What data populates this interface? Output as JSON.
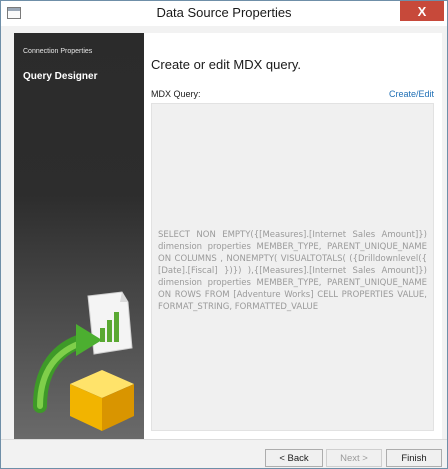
{
  "window": {
    "title": "Data Source Properties",
    "close_glyph": "X"
  },
  "sidebar": {
    "items": [
      {
        "label": "Connection Properties"
      },
      {
        "label": "Query Designer"
      }
    ],
    "illustration_icon": "wizard-cube-arrow-chart-icon"
  },
  "main": {
    "heading": "Create or edit MDX query.",
    "query_label": "MDX Query:",
    "create_edit_link": "Create/Edit",
    "query_text": "SELECT NON EMPTY({[Measures].[Internet Sales Amount]}) dimension properties MEMBER_TYPE, PARENT_UNIQUE_NAME ON COLUMNS , NONEMPTY( VISUALTOTALS( ({Drilldownlevel({ [Date].[Fiscal] })}) ),{[Measures].[Internet Sales Amount]}) dimension properties MEMBER_TYPE, PARENT_UNIQUE_NAME ON ROWS FROM [Adventure Works] CELL PROPERTIES VALUE, FORMAT_STRING, FORMATTED_VALUE"
  },
  "footer": {
    "back_label": "< Back",
    "next_label": "Next >",
    "finish_label": "Finish"
  },
  "colors": {
    "close_button": "#c7493a",
    "link": "#1f6fb5",
    "sidebar_dark": "#2b2b2b"
  }
}
